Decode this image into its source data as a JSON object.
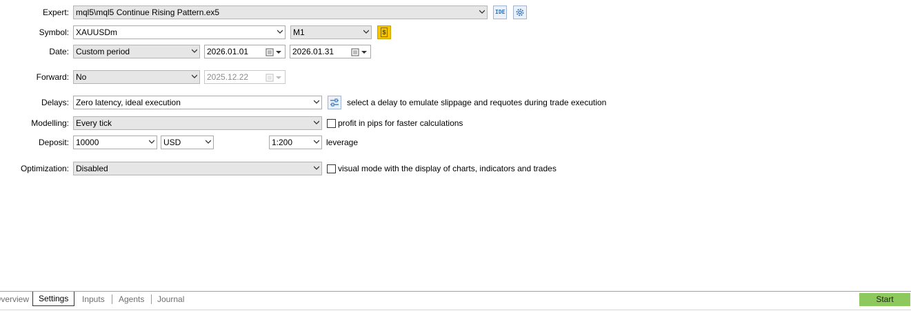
{
  "expert": {
    "label": "Expert:",
    "value": "mql5\\mql5 Continue Rising Pattern.ex5",
    "ide_label": "IDE"
  },
  "symbol": {
    "label": "Symbol:",
    "value": "XAUUSDm",
    "timeframe": "M1"
  },
  "date": {
    "label": "Date:",
    "period": "Custom period",
    "from": "2026.01.01",
    "to": "2026.01.31"
  },
  "forward": {
    "label": "Forward:",
    "value": "No",
    "date": "2025.12.22"
  },
  "delays": {
    "label": "Delays:",
    "value": "Zero latency, ideal execution",
    "hint": "select a delay to emulate slippage and requotes during trade execution"
  },
  "modelling": {
    "label": "Modelling:",
    "value": "Every tick",
    "checkbox_label": "profit in pips for faster calculations",
    "checked": false
  },
  "deposit": {
    "label": "Deposit:",
    "amount": "10000",
    "currency": "USD",
    "leverage": "1:200",
    "leverage_label": "leverage"
  },
  "optimization": {
    "label": "Optimization:",
    "value": "Disabled",
    "checkbox_label": "visual mode with the display of charts, indicators and trades",
    "checked": false
  },
  "tabs": [
    {
      "label": "Overview",
      "active": false
    },
    {
      "label": "Settings",
      "active": true
    },
    {
      "label": "Inputs",
      "active": false
    },
    {
      "label": "Agents",
      "active": false
    },
    {
      "label": "Journal",
      "active": false
    }
  ],
  "start_label": "Start",
  "colors": {
    "start": "#8dc95c",
    "symbol_icon": "#f2c200",
    "accent_icon": "#2f6fb8"
  }
}
